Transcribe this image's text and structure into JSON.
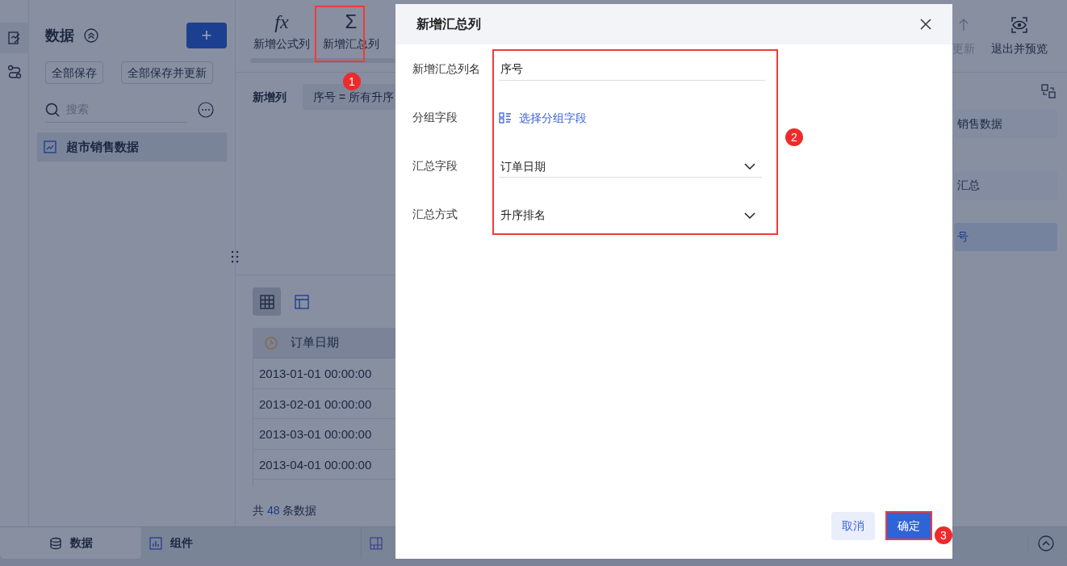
{
  "data_panel": {
    "title": "数据",
    "add_button": "+",
    "buttons": [
      "全部保存",
      "全部保存并更新"
    ],
    "search": {
      "placeholder": "搜索"
    },
    "tables": [
      {
        "label": "超市销售数据",
        "selected": true
      }
    ]
  },
  "toolbar": {
    "items": [
      {
        "symbol": "fx",
        "label": "新增公式列"
      },
      {
        "symbol": "Σ",
        "label": "新增汇总列"
      }
    ]
  },
  "right_toolbar": {
    "items": [
      {
        "kind": "update",
        "label": "更新",
        "disabled": true
      },
      {
        "kind": "preview",
        "label": "退出并预览",
        "disabled": false
      }
    ]
  },
  "new_columns": {
    "label": "新增列",
    "chip": "序号 = 所有升序"
  },
  "preview": {
    "views": [
      {
        "kind": "grid",
        "selected": true
      },
      {
        "kind": "layout",
        "selected": false
      }
    ],
    "columns": [
      "订单日期"
    ],
    "rows": [
      [
        "2013-01-01 00:00:00"
      ],
      [
        "2013-02-01 00:00:00"
      ],
      [
        "2013-03-01 00:00:00"
      ],
      [
        "2013-04-01 00:00:00"
      ]
    ],
    "count_prefix": "共",
    "count": "48",
    "count_suffix": "条数据"
  },
  "right_panel": {
    "items": [
      {
        "label": "销售数据",
        "selected": false
      },
      {
        "label": "汇总",
        "selected": false
      },
      {
        "label": "号",
        "selected": true
      }
    ]
  },
  "bottom_tabs": [
    {
      "kind": "data",
      "label": "数据",
      "selected": true
    },
    {
      "kind": "widget",
      "label": "组件",
      "selected": false
    },
    {
      "kind": "dashboard",
      "selected": false
    }
  ],
  "dialog": {
    "title": "新增汇总列",
    "fields": [
      {
        "kind": "input",
        "label": "新增汇总列名",
        "value": "序号"
      },
      {
        "kind": "picker",
        "label": "分组字段",
        "value": "选择分组字段"
      },
      {
        "kind": "select",
        "label": "汇总字段",
        "value": "订单日期"
      },
      {
        "kind": "select",
        "label": "汇总方式",
        "value": "升序排名"
      }
    ],
    "buttons": [
      {
        "kind": "secondary",
        "label": "取消"
      },
      {
        "kind": "primary",
        "label": "确定"
      }
    ]
  },
  "annotations": [
    "1",
    "2",
    "3"
  ]
}
